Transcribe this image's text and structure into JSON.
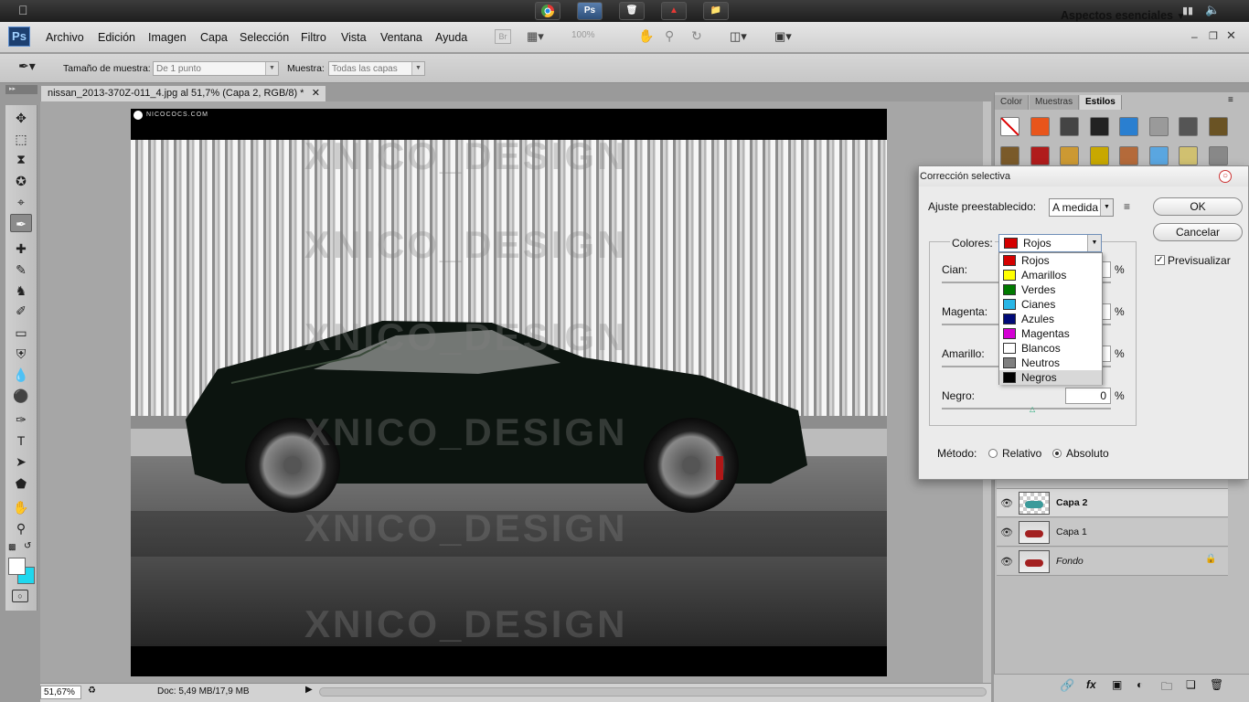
{
  "os_taskbar": {
    "icons": [
      "chrome-icon",
      "photoshop-icon",
      "recycle-bin-icon",
      "acrobat-icon",
      "folder-icon"
    ]
  },
  "app": {
    "logo": "Ps",
    "menu": [
      "Archivo",
      "Edición",
      "Imagen",
      "Capa",
      "Selección",
      "Filtro",
      "Vista",
      "Ventana",
      "Ayuda"
    ],
    "bridge_label": "Br",
    "zoom_field": "100%",
    "workspace": "Aspectos esenciales"
  },
  "options_bar": {
    "sample_size_label": "Tamaño de muestra:",
    "sample_size_value": "De 1 punto",
    "sample_label": "Muestra:",
    "sample_value": "Todas las capas"
  },
  "document": {
    "tab_title": "nissan_2013-370Z-011_4.jpg al 51,7% (Capa 2, RGB/8) *",
    "canvas_header_text": "NICOCOCS.COM",
    "watermark": "XNICO_DESIGN",
    "zoom_status": "51,67%",
    "doc_status": "Doc: 5,49 MB/17,9 MB"
  },
  "panels": {
    "tabs": [
      "Color",
      "Muestras",
      "Estilos"
    ],
    "active_tab": "Estilos"
  },
  "layers": [
    {
      "name": "Capa 2",
      "active": true
    },
    {
      "name": "Capa 1",
      "active": false
    },
    {
      "name": "Fondo",
      "active": false
    }
  ],
  "dialog": {
    "title": "Corrección selectiva",
    "preset_label": "Ajuste preestablecido:",
    "preset_value": "A medida",
    "ok": "OK",
    "cancel": "Cancelar",
    "preview_label": "Previsualizar",
    "colors_label": "Colores:",
    "colors_selected": "Rojos",
    "colors_options": [
      {
        "label": "Rojos",
        "color": "#d40000"
      },
      {
        "label": "Amarillos",
        "color": "#ffff00"
      },
      {
        "label": "Verdes",
        "color": "#007a00"
      },
      {
        "label": "Cianes",
        "color": "#29b6e6"
      },
      {
        "label": "Azules",
        "color": "#000a78"
      },
      {
        "label": "Magentas",
        "color": "#d400d4"
      },
      {
        "label": "Blancos",
        "color": "#ffffff"
      },
      {
        "label": "Neutros",
        "color": "#808080"
      },
      {
        "label": "Negros",
        "color": "#000000"
      }
    ],
    "highlighted_option": "Negros",
    "sliders": [
      {
        "label": "Cian:",
        "value": "",
        "unit": "%"
      },
      {
        "label": "Magenta:",
        "value": "",
        "unit": "%"
      },
      {
        "label": "Amarillo:",
        "value": "",
        "unit": "%"
      },
      {
        "label": "Negro:",
        "value": "0",
        "unit": "%"
      }
    ],
    "method_label": "Método:",
    "method_relative": "Relativo",
    "method_absolute": "Absoluto",
    "method_selected": "Absoluto"
  }
}
